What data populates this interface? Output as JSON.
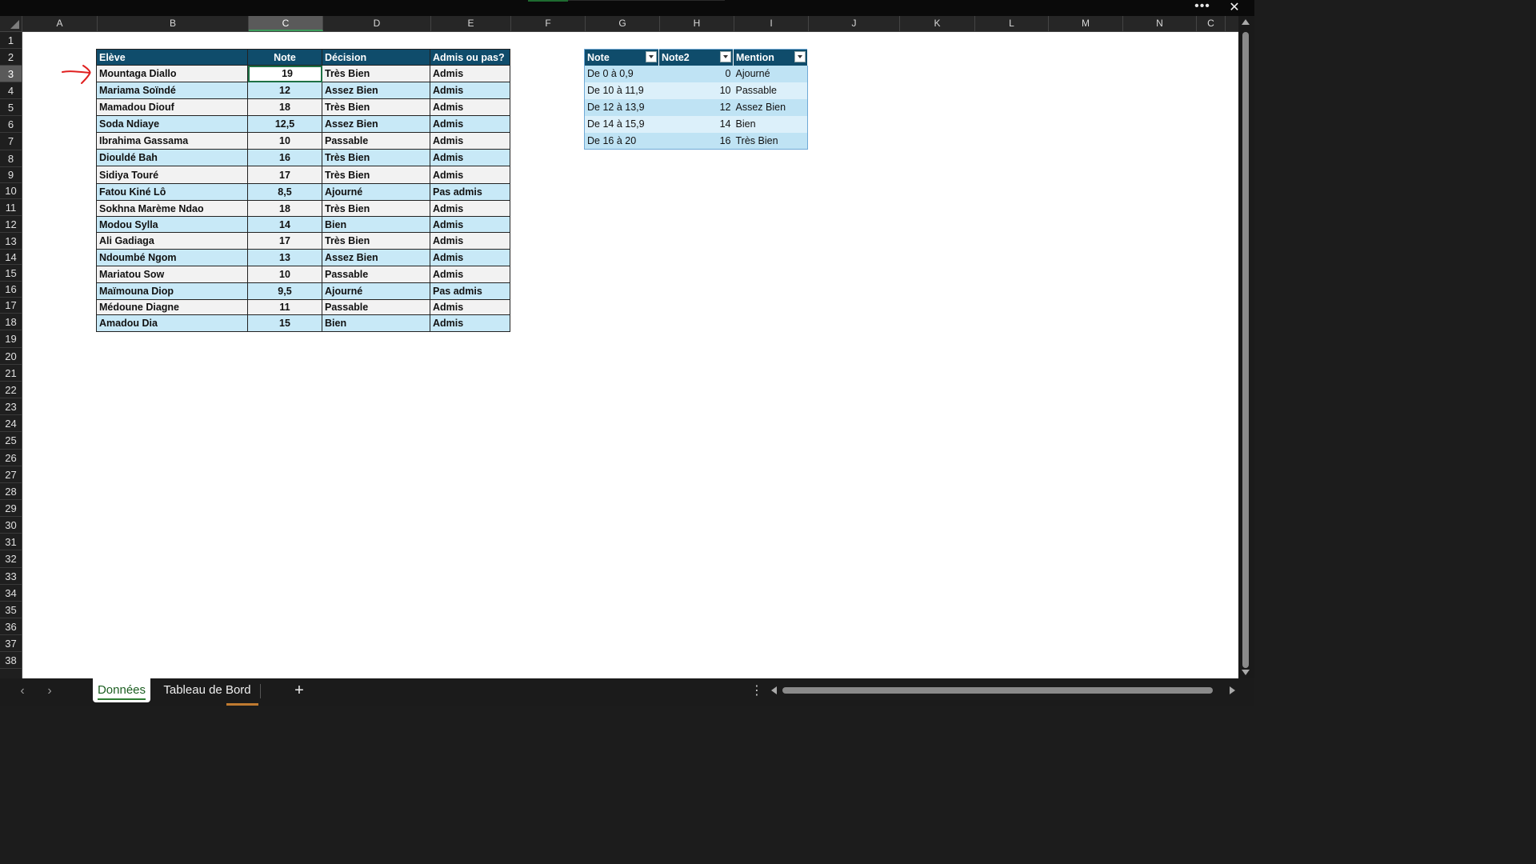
{
  "window": {
    "more_label": "•••",
    "close_label": "✕"
  },
  "columns": [
    "A",
    "B",
    "C",
    "D",
    "E",
    "F",
    "G",
    "H",
    "I",
    "J",
    "K",
    "L",
    "M",
    "N",
    "C"
  ],
  "selected_column": "C",
  "rows": [
    "1",
    "2",
    "3",
    "4",
    "5",
    "6",
    "7",
    "8",
    "9",
    "10",
    "11",
    "12",
    "13",
    "14",
    "15",
    "16",
    "17",
    "18",
    "19",
    "20",
    "21",
    "22",
    "23",
    "24",
    "25",
    "26",
    "27",
    "28",
    "29",
    "30",
    "31",
    "32",
    "33",
    "34",
    "35",
    "36",
    "37",
    "38"
  ],
  "selected_row": "3",
  "main_table": {
    "headers": [
      "Elève",
      "Note",
      "Décision",
      "Admis ou pas?"
    ],
    "rows": [
      [
        "Mountaga Diallo",
        "19",
        "Très Bien",
        "Admis"
      ],
      [
        "Mariama Soïndé",
        "12",
        "Assez Bien",
        "Admis"
      ],
      [
        "Mamadou Diouf",
        "18",
        "Très Bien",
        "Admis"
      ],
      [
        "Soda Ndiaye",
        "12,5",
        "Assez Bien",
        "Admis"
      ],
      [
        "Ibrahima Gassama",
        "10",
        "Passable",
        "Admis"
      ],
      [
        "Diouldé Bah",
        "16",
        "Très Bien",
        "Admis"
      ],
      [
        "Sidiya Touré",
        "17",
        "Très Bien",
        "Admis"
      ],
      [
        "Fatou Kiné Lô",
        "8,5",
        "Ajourné",
        "Pas admis"
      ],
      [
        "Sokhna Marème Ndao",
        "18",
        "Très Bien",
        "Admis"
      ],
      [
        "Modou Sylla",
        "14",
        "Bien",
        "Admis"
      ],
      [
        "Ali Gadiaga",
        "17",
        "Très Bien",
        "Admis"
      ],
      [
        "Ndoumbé Ngom",
        "13",
        "Assez Bien",
        "Admis"
      ],
      [
        "Mariatou Sow",
        "10",
        "Passable",
        "Admis"
      ],
      [
        "Maïmouna Diop",
        "9,5",
        "Ajourné",
        "Pas admis"
      ],
      [
        "Médoune Diagne",
        "11",
        "Passable",
        "Admis"
      ],
      [
        "Amadou Dia",
        "15",
        "Bien",
        "Admis"
      ]
    ]
  },
  "mention_table": {
    "headers": [
      "Note",
      "Note2",
      "Mention"
    ],
    "rows": [
      [
        "De 0 à 0,9",
        "0",
        "Ajourné"
      ],
      [
        "De 10 à 11,9",
        "10",
        "Passable"
      ],
      [
        "De 12 à 13,9",
        "12",
        "Assez Bien"
      ],
      [
        "De 14 à 15,9",
        "14",
        "Bien"
      ],
      [
        "De 16 à 20",
        "16",
        "Très Bien"
      ]
    ]
  },
  "sheet_tabs": [
    "Données",
    "Tableau de Bord"
  ],
  "active_tab": "Données",
  "add_sheet_label": "+",
  "nav": {
    "prev": "‹",
    "next": "›",
    "options": "⋮"
  },
  "colors": {
    "header_bg": "#0f4c6b",
    "band_blue": "#c8e9f7",
    "band_grey": "#f2f2f2",
    "arrow": "#e02020"
  }
}
